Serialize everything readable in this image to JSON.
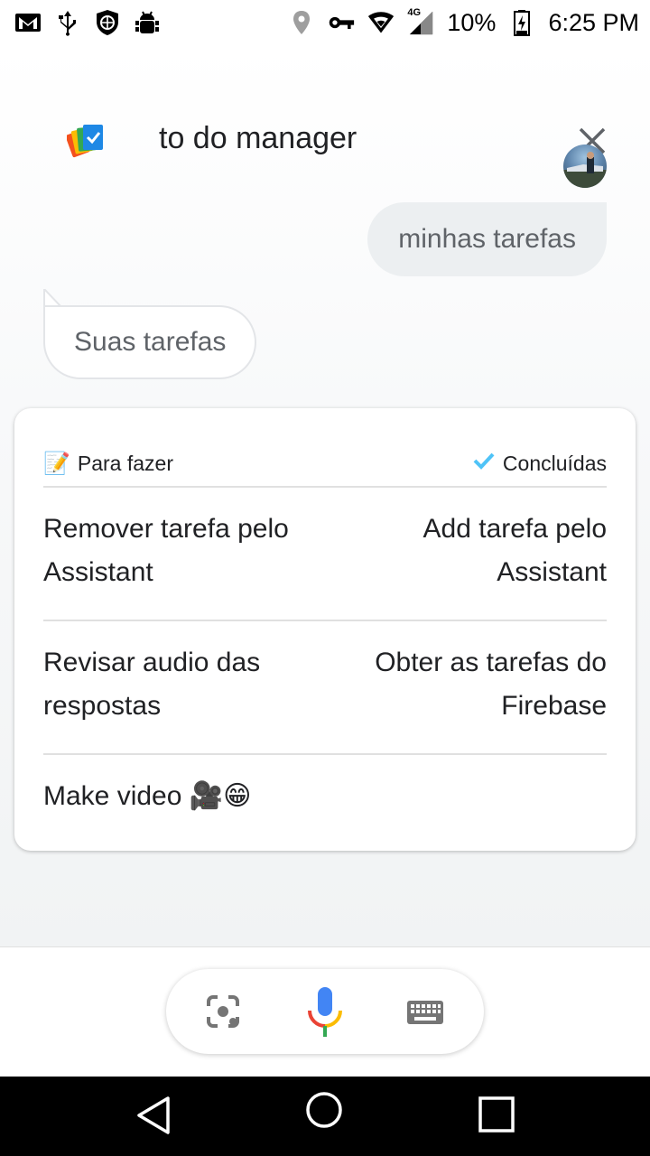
{
  "status_bar": {
    "battery": "10%",
    "time": "6:25 PM",
    "network": "4G",
    "left_icons": [
      "gmail-icon",
      "usb-icon",
      "vpn-shield-icon",
      "android-debug-icon"
    ],
    "right_icons": [
      "location-icon",
      "key-icon",
      "wifi-icon",
      "cell-signal-icon",
      "battery-icon"
    ]
  },
  "header": {
    "query": "to do manager",
    "logo_icon": "todo-manager-logo-icon",
    "close_icon": "close-icon"
  },
  "conversation": {
    "user_message": "minhas tarefas",
    "assistant_message": "Suas tarefas"
  },
  "card": {
    "todo_emoji": "📝",
    "todo_label": "Para fazer",
    "done_label": "Concluídas",
    "rows": [
      {
        "left": "Remover tarefa pelo Assistant",
        "right": "Add tarefa pelo Assistant"
      },
      {
        "left": "Revisar audio das respostas",
        "right": "Obter as tarefas do Firebase"
      },
      {
        "left": "Make video 🎥😁",
        "right": ""
      }
    ]
  },
  "input_bar": {
    "icons": [
      "lens-icon",
      "mic-icon",
      "keyboard-icon"
    ]
  },
  "colors": {
    "check": "#4fc3f7",
    "mic_blue": "#4285f4",
    "mic_red": "#ea4335",
    "mic_yellow": "#fbbc04",
    "mic_green": "#34a853"
  }
}
